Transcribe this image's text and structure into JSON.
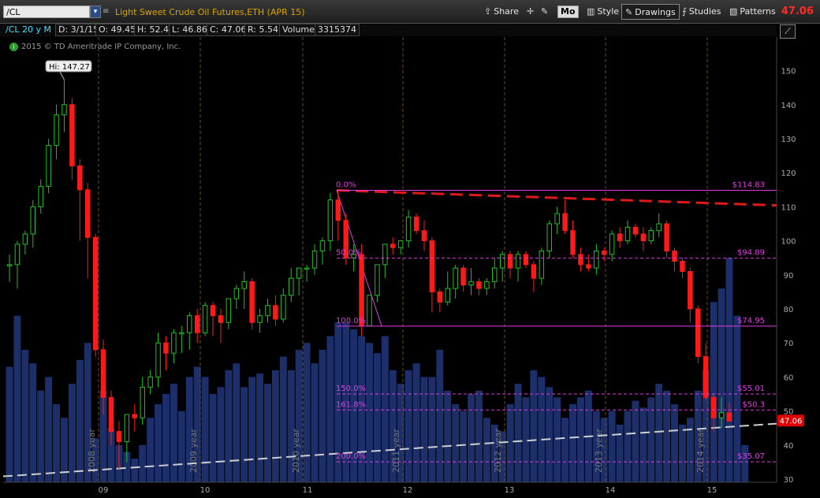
{
  "toolbar": {
    "symbol": "/CL",
    "description": "Light Sweet Crude Oil Futures,ETH (APR 15)",
    "buttons": {
      "share": "Share",
      "mo": "Mo",
      "style": "Style",
      "drawings": "Drawings",
      "studies": "Studies",
      "patterns": "Patterns"
    },
    "last_price": "47.06"
  },
  "infobar": {
    "symbol_period": "/CL 20 y M",
    "date": "D: 3/1/15",
    "open": "O: 49.45",
    "high": "H: 52.4",
    "low": "L: 46.86",
    "close": "C: 47.06",
    "range": "R: 5.54",
    "volume_label": "Volume",
    "volume_value": "3315374"
  },
  "copyright": "2015 © TD Ameritrade IP Company, Inc.",
  "colors": {
    "up": "#22c022",
    "down": "#ff1a1a",
    "volume": "#1c2f6a",
    "fib": "#e03ce0",
    "trend": "#e01a1a",
    "support": "#cfcfcf",
    "grid": "#6a4a22"
  },
  "chart_data": {
    "type": "candlestick",
    "title": "Light Sweet Crude Oil Futures,ETH (APR 15)",
    "period": "Monthly",
    "ylim": [
      30,
      155
    ],
    "y_ticks": [
      "30",
      "40",
      "50",
      "60",
      "70",
      "80",
      "90",
      "100",
      "110",
      "120",
      "130",
      "140",
      "150"
    ],
    "x_ticks": [
      "09",
      "10",
      "11",
      "12",
      "13",
      "14",
      "15"
    ],
    "year_labels": [
      "2008 year",
      "2009 year",
      "2010 year",
      "2011 year",
      "2012 year",
      "2013 year",
      "2014 year"
    ],
    "high_label": "Hi: 147.27",
    "current_price_label": "47.06",
    "fibonacci": [
      {
        "level": "0.0%",
        "price": 114.83,
        "price_label": "$114.83"
      },
      {
        "level": "50.0%",
        "price": 94.89,
        "price_label": "$94.89"
      },
      {
        "level": "100.0%",
        "price": 74.95,
        "price_label": "$74.95"
      },
      {
        "level": "150.0%",
        "price": 55.01,
        "price_label": "$55.01"
      },
      {
        "level": "161.8%",
        "price": 50.3,
        "price_label": "$50.3"
      },
      {
        "level": "200.0%",
        "price": 35.07,
        "price_label": "$35.07"
      }
    ],
    "candles": [
      [
        93,
        96,
        88,
        93
      ],
      [
        93,
        100,
        86,
        99
      ],
      [
        99,
        103,
        96,
        102
      ],
      [
        102,
        112,
        98,
        110
      ],
      [
        110,
        118,
        108,
        116
      ],
      [
        116,
        130,
        114,
        128
      ],
      [
        128,
        140,
        124,
        137
      ],
      [
        137,
        147.3,
        132,
        140
      ],
      [
        140,
        142,
        118,
        122
      ],
      [
        122,
        124,
        100,
        115
      ],
      [
        115,
        117,
        89,
        101
      ],
      [
        101,
        102,
        66,
        68
      ],
      [
        68,
        71,
        49,
        54
      ],
      [
        54,
        56,
        40,
        44
      ],
      [
        44,
        47,
        33,
        41
      ],
      [
        41,
        49,
        35,
        49
      ],
      [
        49,
        52,
        44,
        48
      ],
      [
        48,
        60,
        46,
        57
      ],
      [
        57,
        62,
        55,
        60
      ],
      [
        60,
        73,
        57,
        70
      ],
      [
        70,
        72,
        62,
        67
      ],
      [
        67,
        74,
        64,
        73
      ],
      [
        73,
        75,
        67,
        73
      ],
      [
        73,
        79,
        68,
        78
      ],
      [
        78,
        80,
        70,
        73
      ],
      [
        73,
        82,
        72,
        81
      ],
      [
        81,
        82,
        72,
        78
      ],
      [
        78,
        80,
        70,
        76
      ],
      [
        76,
        82,
        74,
        83
      ],
      [
        83,
        87,
        80,
        86
      ],
      [
        86,
        91,
        80,
        88
      ],
      [
        88,
        89,
        74,
        76
      ],
      [
        76,
        80,
        73,
        78
      ],
      [
        78,
        83,
        76,
        81
      ],
      [
        81,
        84,
        75,
        77
      ],
      [
        77,
        86,
        76,
        84
      ],
      [
        84,
        92,
        82,
        89
      ],
      [
        89,
        92,
        84,
        92
      ],
      [
        92,
        93,
        88,
        92
      ],
      [
        92,
        99,
        90,
        97
      ],
      [
        97,
        101,
        93,
        100
      ],
      [
        100,
        114,
        97,
        112
      ],
      [
        112,
        115,
        100,
        106
      ],
      [
        106,
        108,
        93,
        95
      ],
      [
        95,
        99,
        91,
        96
      ],
      [
        96,
        99,
        72,
        75
      ],
      [
        75,
        84,
        75,
        84
      ],
      [
        84,
        92,
        82,
        93
      ],
      [
        93,
        99,
        89,
        99
      ],
      [
        99,
        101,
        96,
        98
      ],
      [
        98,
        100,
        96,
        100
      ],
      [
        100,
        109,
        98,
        107
      ],
      [
        107,
        108,
        102,
        103
      ],
      [
        103,
        106,
        97,
        100
      ],
      [
        100,
        101,
        79,
        85
      ],
      [
        85,
        86,
        79,
        82
      ],
      [
        82,
        91,
        81,
        86
      ],
      [
        86,
        93,
        83,
        92
      ],
      [
        92,
        93,
        85,
        87
      ],
      [
        87,
        92,
        84,
        88
      ],
      [
        88,
        89,
        84,
        86
      ],
      [
        86,
        89,
        84,
        88
      ],
      [
        88,
        95,
        86,
        92
      ],
      [
        92,
        97,
        88,
        96
      ],
      [
        96,
        97,
        89,
        92
      ],
      [
        92,
        97,
        88,
        96
      ],
      [
        96,
        97,
        92,
        93
      ],
      [
        93,
        94,
        85,
        89
      ],
      [
        89,
        98,
        87,
        97
      ],
      [
        97,
        106,
        95,
        105
      ],
      [
        105,
        110,
        102,
        108
      ],
      [
        108,
        112,
        102,
        103
      ],
      [
        103,
        106,
        95,
        96
      ],
      [
        96,
        98,
        91,
        93
      ],
      [
        93,
        96,
        91,
        92
      ],
      [
        92,
        99,
        90,
        97
      ],
      [
        97,
        98,
        94,
        96
      ],
      [
        96,
        103,
        94,
        102
      ],
      [
        102,
        104,
        98,
        100
      ],
      [
        100,
        106,
        99,
        104
      ],
      [
        104,
        105,
        101,
        102
      ],
      [
        102,
        104,
        97,
        100
      ],
      [
        100,
        104,
        99,
        103
      ],
      [
        103,
        108,
        101,
        105
      ],
      [
        105,
        106,
        95,
        97
      ],
      [
        97,
        98,
        91,
        94
      ],
      [
        94,
        95,
        89,
        91
      ],
      [
        91,
        92,
        76,
        80
      ],
      [
        80,
        81,
        64,
        66
      ],
      [
        66,
        70,
        53,
        54
      ],
      [
        54,
        55,
        44,
        48
      ],
      [
        48,
        54,
        45,
        49.5
      ],
      [
        49.45,
        52.4,
        46.86,
        47.06
      ]
    ],
    "volume_scale_top": 155,
    "volumes": [
      63,
      78,
      68,
      64,
      56,
      60,
      52,
      48,
      58,
      65,
      70,
      42,
      56,
      45,
      40,
      38,
      36,
      40,
      48,
      52,
      55,
      58,
      50,
      60,
      63,
      60,
      55,
      57,
      62,
      64,
      57,
      60,
      61,
      58,
      62,
      66,
      62,
      68,
      70,
      64,
      68,
      72,
      76,
      76,
      74,
      72,
      70,
      67,
      72,
      62,
      58,
      62,
      64,
      60,
      60,
      68,
      56,
      52,
      50,
      55,
      56,
      48,
      46,
      44,
      52,
      58,
      54,
      62,
      60,
      57,
      54,
      48,
      52,
      54,
      56,
      50,
      48,
      50,
      46,
      50,
      53,
      51,
      54,
      58,
      56,
      52,
      46,
      48,
      56,
      62,
      82,
      86,
      95,
      78,
      40
    ]
  }
}
